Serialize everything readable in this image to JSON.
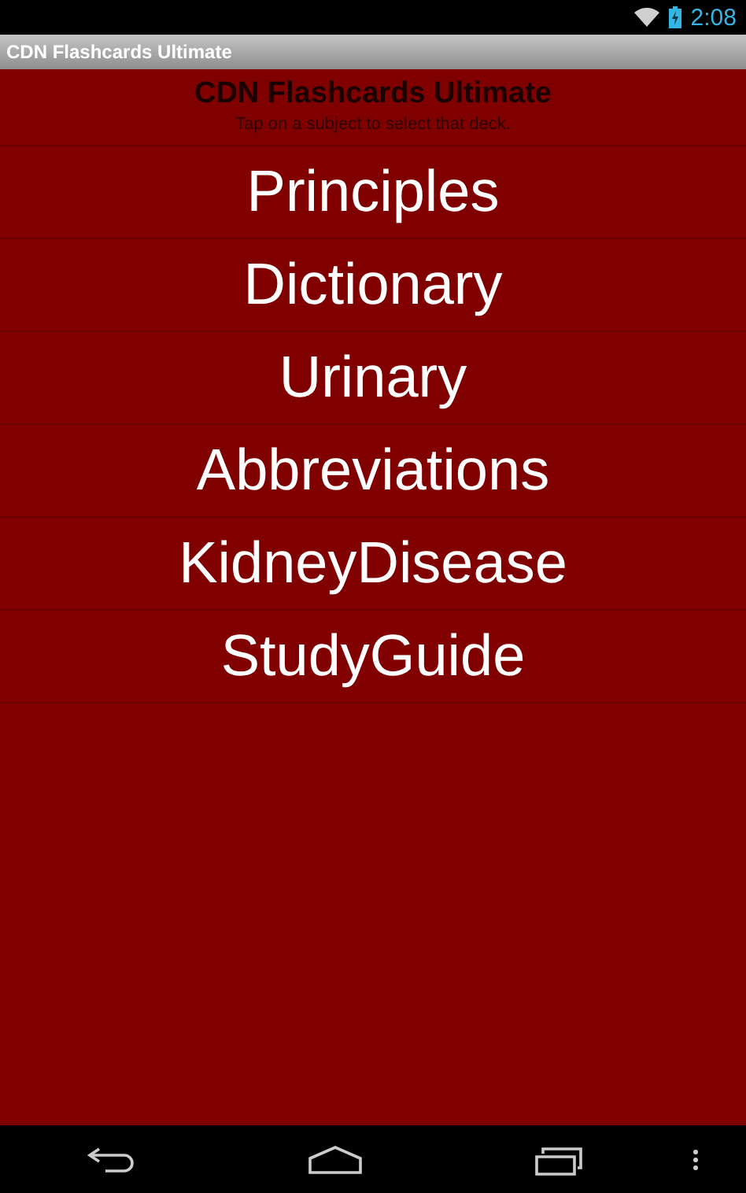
{
  "status_bar": {
    "time": "2:08"
  },
  "window": {
    "title": "CDN Flashcards Ultimate"
  },
  "header": {
    "title": "CDN Flashcards Ultimate",
    "subtitle": "Tap on a subject to select that deck."
  },
  "subjects": [
    {
      "label": "Principles"
    },
    {
      "label": "Dictionary"
    },
    {
      "label": "Urinary"
    },
    {
      "label": "Abbreviations"
    },
    {
      "label": "KidneyDisease"
    },
    {
      "label": "StudyGuide"
    }
  ]
}
